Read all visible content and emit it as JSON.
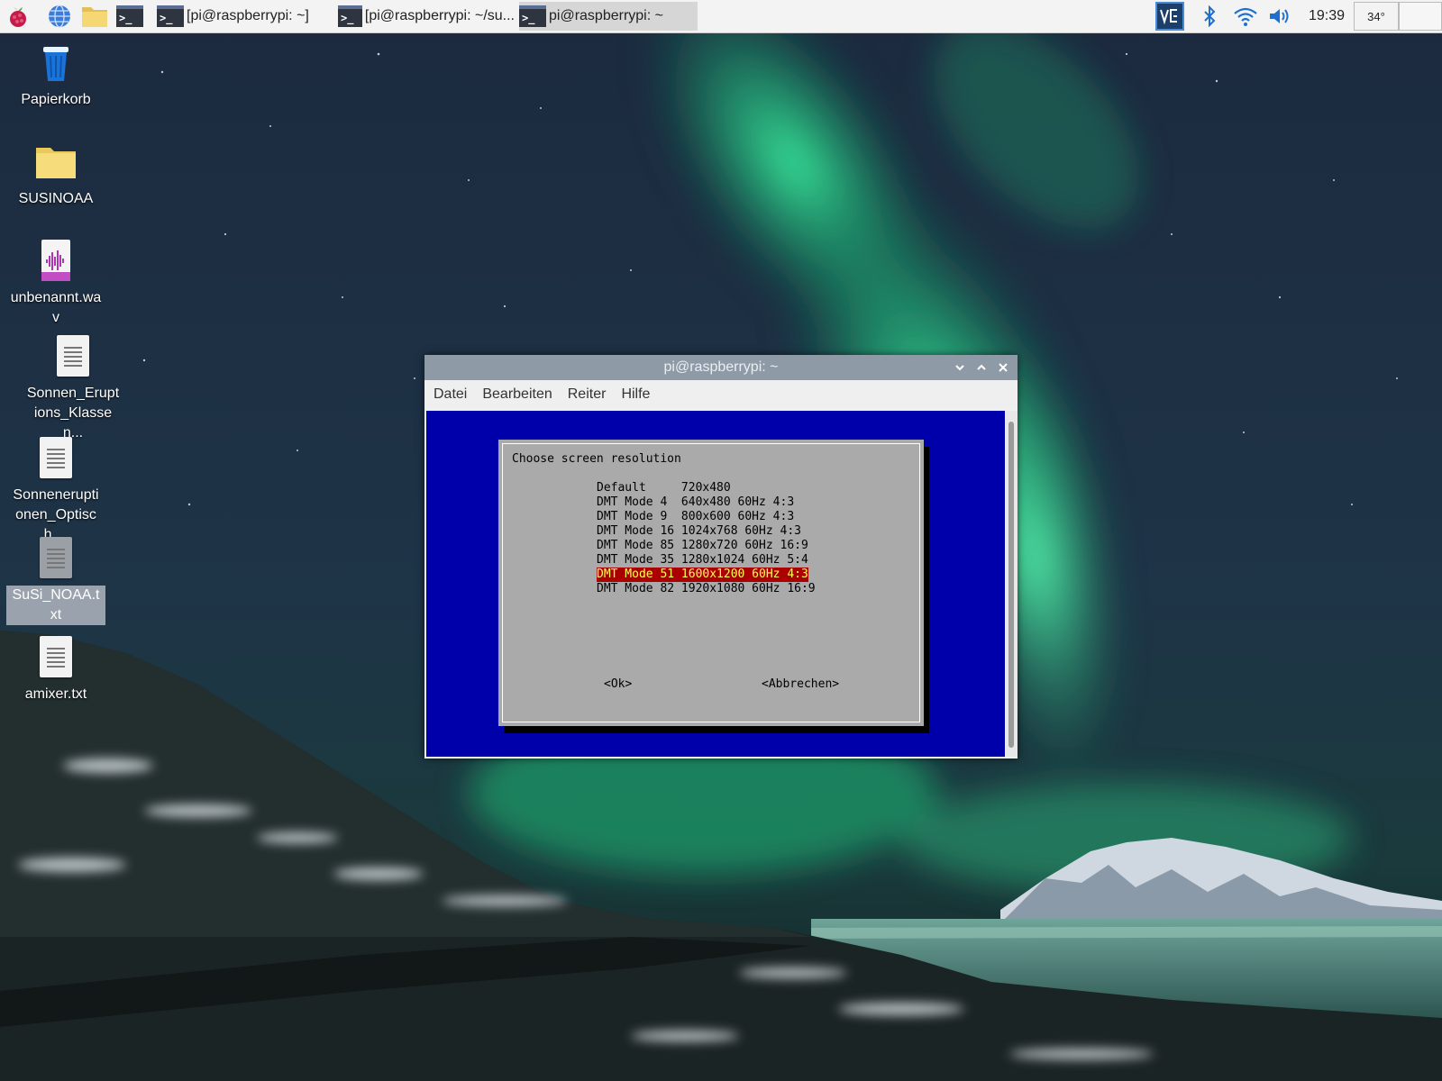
{
  "taskbar": {
    "launchers": [
      "raspberry-menu",
      "web-browser",
      "file-manager",
      "terminal"
    ],
    "tasks": [
      {
        "label": "[pi@raspberrypi: ~]",
        "active": false
      },
      {
        "label": "[pi@raspberrypi: ~/su...",
        "active": false
      },
      {
        "label": "pi@raspberrypi: ~",
        "active": true
      }
    ],
    "tray": {
      "vnc_icon": "vnc-icon",
      "bluetooth_icon": "bluetooth-icon",
      "wifi_icon": "wifi-icon",
      "volume_icon": "volume-icon",
      "clock": "19:39",
      "temperature": "34°"
    }
  },
  "desktop_icons": [
    {
      "label": "Papierkorb",
      "icon": "trash-icon"
    },
    {
      "label": "SUSINOAA",
      "icon": "folder-icon"
    },
    {
      "label": "unbenannt.wav",
      "icon": "audio-file-icon"
    },
    {
      "label": "Sonnen_Eruptions_Klassen...",
      "icon": "text-file-icon"
    },
    {
      "label": "Sonneneruptionen_Optisch....",
      "icon": "text-file-icon"
    },
    {
      "label": "SuSi_NOAA.txt",
      "icon": "text-file-icon",
      "selected": true
    },
    {
      "label": "amixer.txt",
      "icon": "text-file-icon"
    }
  ],
  "window": {
    "title": "pi@raspberrypi: ~",
    "menu": [
      "Datei",
      "Bearbeiten",
      "Reiter",
      "Hilfe"
    ]
  },
  "dialog": {
    "title": "Choose screen resolution",
    "options": [
      "Default     720x480",
      "DMT Mode 4  640x480 60Hz 4:3",
      "DMT Mode 9  800x600 60Hz 4:3",
      "DMT Mode 16 1024x768 60Hz 4:3",
      "DMT Mode 85 1280x720 60Hz 16:9",
      "DMT Mode 35 1280x1024 60Hz 5:4",
      "DMT Mode 51 1600x1200 60Hz 4:3",
      "DMT Mode 82 1920x1080 60Hz 16:9"
    ],
    "selected_index": 6,
    "ok_label": "<Ok>",
    "cancel_label": "<Abbrechen>"
  },
  "colors": {
    "terminal_bg": "#0000aa",
    "dialog_bg": "#aaaaaa",
    "selection_bg": "#aa0000",
    "selection_fg": "#ffff55",
    "titlebar": "#8f9aa7"
  }
}
